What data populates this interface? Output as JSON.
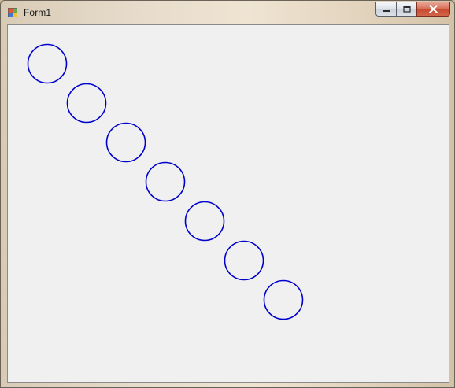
{
  "window": {
    "title": "Form1",
    "icon": "winforms-app-icon",
    "caption_buttons": [
      {
        "name": "minimize",
        "icon": "minimize-icon"
      },
      {
        "name": "maximize",
        "icon": "maximize-icon"
      },
      {
        "name": "close",
        "icon": "close-icon"
      }
    ]
  },
  "drawing": {
    "shape": "circle",
    "count": 7,
    "stroke_color": "#0000cc"
  }
}
